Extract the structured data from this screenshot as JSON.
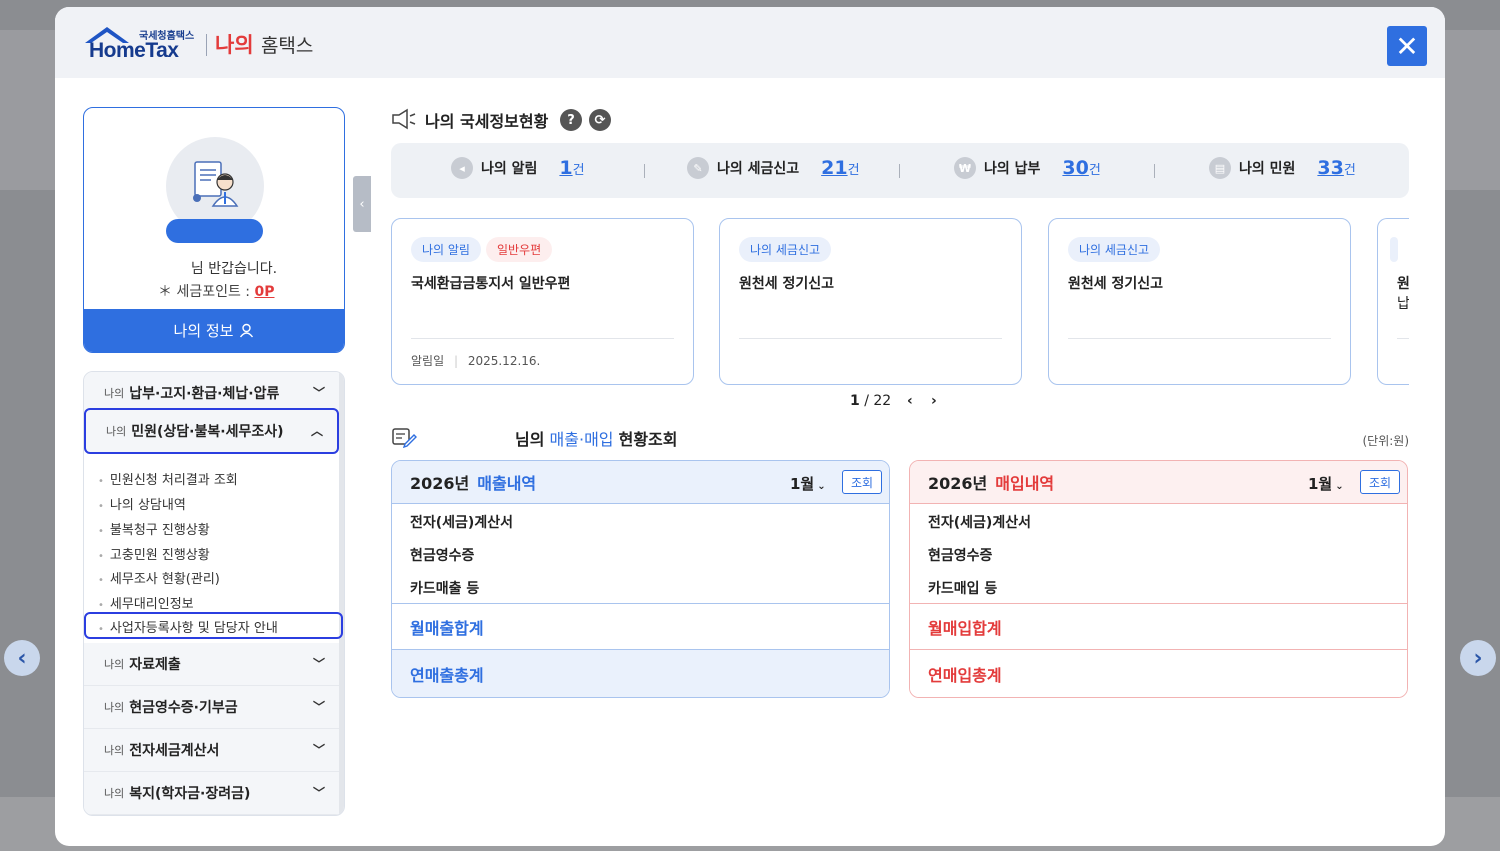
{
  "header": {
    "logo_small": "국세청홈택스",
    "logo_big": "HomeTax",
    "title_red": "나의",
    "title_rest": "홈택스",
    "close_label": "✕"
  },
  "profile": {
    "greeting": "님 반갑습니다.",
    "points_label": "＊ 세금포인트 :",
    "points_value": "0P",
    "my_info_button": "나의 정보"
  },
  "menu": {
    "items": [
      {
        "prefix": "나의",
        "label": "납부·고지·환급·체납·압류"
      },
      {
        "prefix": "나의",
        "label": "민원(상담·불복·세무조사)"
      },
      {
        "prefix": "나의",
        "label": "자료제출"
      },
      {
        "prefix": "나의",
        "label": "현금영수증·기부금"
      },
      {
        "prefix": "나의",
        "label": "전자세금계산서"
      },
      {
        "prefix": "나의",
        "label": "복지(학자금·장려금)"
      }
    ],
    "sub_items": [
      "민원신청 처리결과 조회",
      "나의 상담내역",
      "불복청구 진행상황",
      "고충민원 진행상황",
      "세무조사 현황(관리)",
      "세무대리인정보",
      "사업자등록사항 및 담당자 안내"
    ]
  },
  "status": {
    "title": "나의 국세정보현황",
    "help": "?",
    "refresh": "⟳",
    "items": [
      {
        "label": "나의 알림",
        "count": "1",
        "unit": "건"
      },
      {
        "label": "나의 세금신고",
        "count": "21",
        "unit": "건"
      },
      {
        "label": "나의 납부",
        "count": "30",
        "unit": "건"
      },
      {
        "label": "나의 민원",
        "count": "33",
        "unit": "건"
      }
    ]
  },
  "cards": [
    {
      "tag1": "나의 알림",
      "tag2": "일반우편",
      "title": "국세환급금통지서 일반우편",
      "date_label": "알림일",
      "date": "2025.12.16."
    },
    {
      "tag1": "나의 세금신고",
      "title": "원천세 정기신고"
    },
    {
      "tag1": "나의 세금신고",
      "title": "원천세 정기신고"
    },
    {
      "partial_1": "원",
      "partial_2": "납"
    }
  ],
  "pager": {
    "current": "1",
    "sep": "/",
    "total": "22"
  },
  "sales": {
    "title_prefix": "님의",
    "title_blue": "매출·매입",
    "title_rest": "현황조회",
    "unit": "(단위:원)",
    "sell": {
      "year": "2026년",
      "label": "매출내역",
      "month": "1월",
      "inquiry": "조회",
      "rows": [
        "전자(세금)계산서",
        "현금영수증",
        "카드매출 등"
      ],
      "monthly": "월매출합계",
      "yearly": "연매출총계"
    },
    "buy": {
      "year": "2026년",
      "label": "매입내역",
      "month": "1월",
      "inquiry": "조회",
      "rows": [
        "전자(세금)계산서",
        "현금영수증",
        "카드매입 등"
      ],
      "monthly": "월매입합계",
      "yearly": "연매입총계"
    }
  },
  "colors": {
    "accent": "#2f6fe0",
    "red": "#e33b3b",
    "highlight": "#2b3ee0"
  }
}
